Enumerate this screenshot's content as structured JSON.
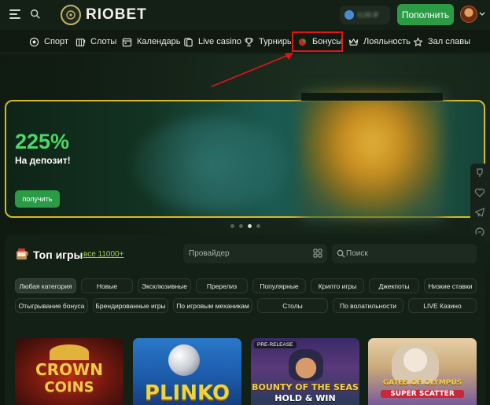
{
  "header": {
    "logo_text": "RIOBET",
    "balance_value": "0,00 ₽",
    "deposit_label": "Пополнить"
  },
  "nav": {
    "items": [
      {
        "label": "Спорт",
        "icon": "soccer-ball-icon"
      },
      {
        "label": "Слоты",
        "icon": "slots-icon"
      },
      {
        "label": "Календарь",
        "icon": "calendar-icon"
      },
      {
        "label": "Live casino",
        "icon": "live-casino-icon"
      },
      {
        "label": "Турниры",
        "icon": "trophy-icon"
      },
      {
        "label": "Бонусы",
        "icon": "gift-icon"
      },
      {
        "label": "Лояльность",
        "icon": "crown-icon"
      },
      {
        "label": "Зал славы",
        "icon": "star-icon"
      }
    ],
    "highlight_color": "#e0151a"
  },
  "banner": {
    "headline": "225%",
    "subline": "На депозит!",
    "button_label": "получить",
    "dots_total": 4,
    "dots_active": 3
  },
  "games": {
    "title": "Топ игры",
    "all_link": "все 11000+",
    "provider_placeholder": "Провайдер",
    "search_placeholder": "Поиск",
    "chips_row1": [
      "Любая категория",
      "Новые",
      "Эксклюзивные",
      "Пререлиз",
      "Популярные",
      "Крипто игры",
      "Джекпоты",
      "Низкие ставки"
    ],
    "chips_row2": [
      "Отыгрывание бонуса",
      "Брендированные игры",
      "По игровым механикам",
      "Столы",
      "По волатильности",
      "LIVE Казино"
    ],
    "cards": [
      {
        "title_line1": "CROWN",
        "title_line2": "COINS"
      },
      {
        "title_line1": "PLINKO",
        "title_line2": ""
      },
      {
        "badge": "PRE-RELEASE",
        "title_line1": "BOUNTY OF THE SEAS",
        "title_line2": "HOLD & WIN"
      },
      {
        "title_line1": "GATES OF OLYMPUS",
        "title_line2": "SUPER SCATTER"
      }
    ]
  },
  "colors": {
    "accent_green": "#2b9b46",
    "banner_border": "#d6b832",
    "link_green": "#9cd24a"
  }
}
